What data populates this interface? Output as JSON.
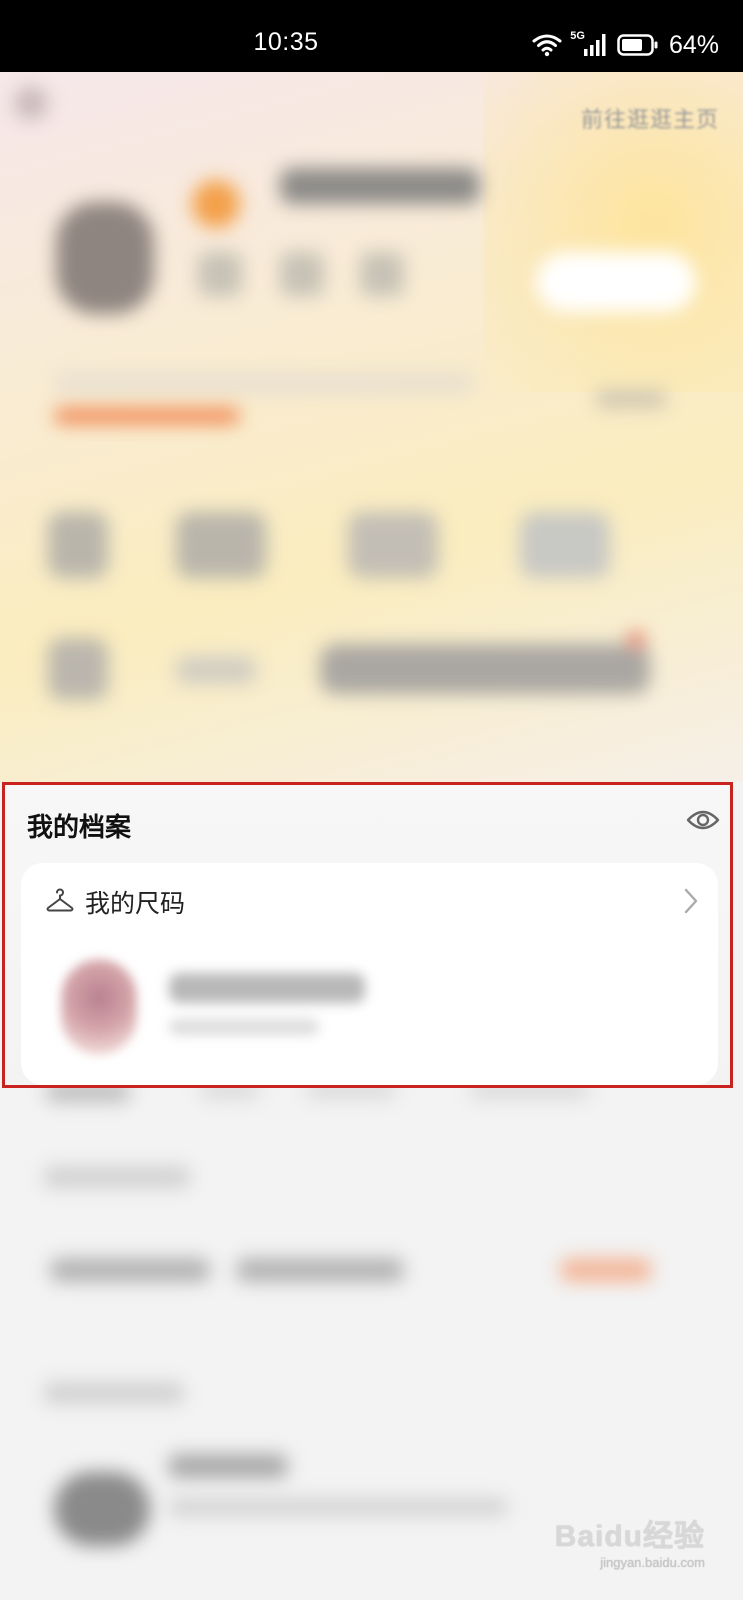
{
  "status_bar": {
    "time": "10:35",
    "network": "5G",
    "battery": "64%"
  },
  "header": {
    "homepage_link": "前往逛逛主页"
  },
  "profile": {
    "title": "我的档案",
    "eye_icon": "eye-icon",
    "size_label": "我的尺码",
    "hanger_icon": "hanger-icon",
    "chevron_icon": "chevron-right-icon",
    "highlight_color": "#c8231e"
  },
  "watermark": {
    "brand": "Baidu经验",
    "url": "jingyan.baidu.com"
  }
}
